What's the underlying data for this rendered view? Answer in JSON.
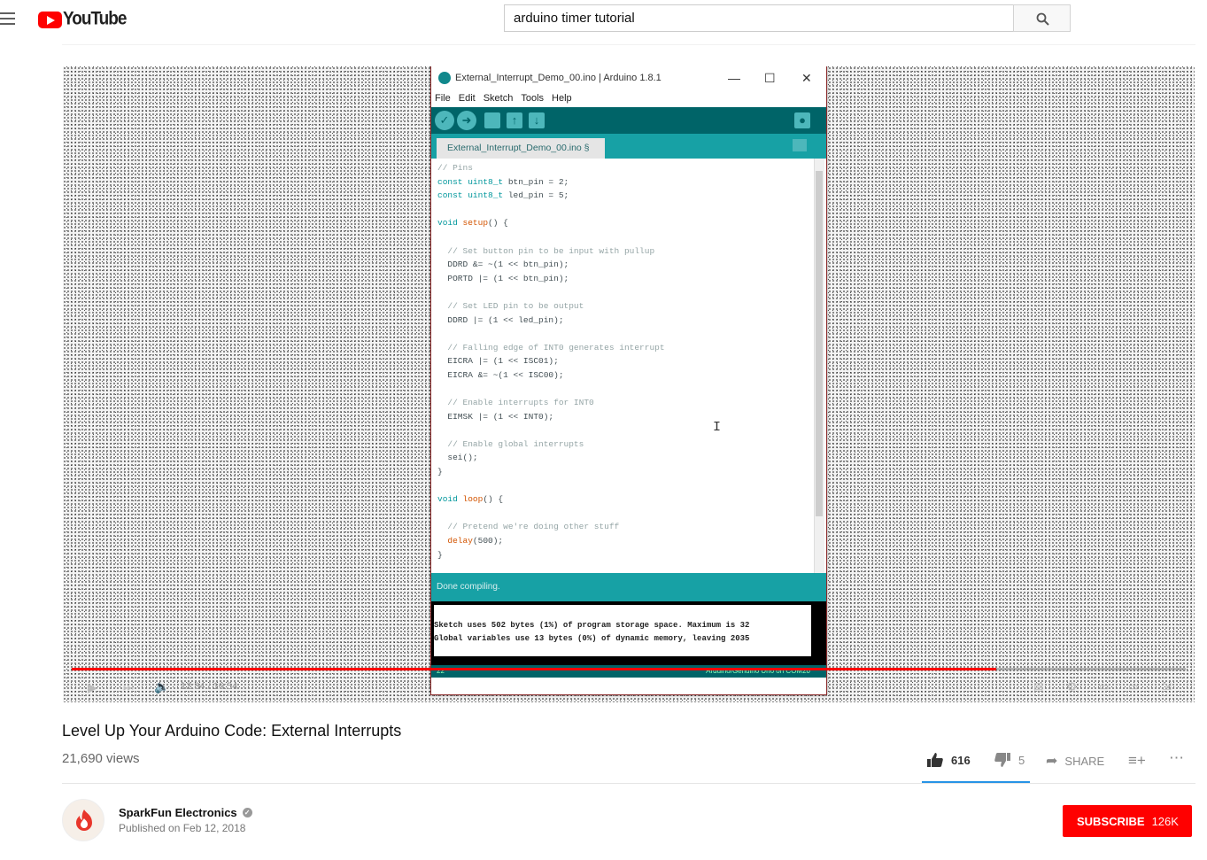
{
  "masthead": {
    "logo_text": "YouTube",
    "search_value": "arduino timer tutorial"
  },
  "player": {
    "time": "12:34 / 16:54",
    "progress_fraction": 0.83
  },
  "ide": {
    "title": "External_Interrupt_Demo_00.ino | Arduino 1.8.1",
    "menu": [
      "File",
      "Edit",
      "Sketch",
      "Tools",
      "Help"
    ],
    "tab_label": "External_Interrupt_Demo_00.ino §",
    "status": "Done compiling.",
    "console_line1": "Sketch uses 502 bytes (1%) of program storage space. Maximum is 32",
    "console_line2": "Global variables use 13 bytes (0%) of dynamic memory, leaving 2035",
    "footer_line": "22",
    "footer_board": "Arduino/Genuino Uno on COM20"
  },
  "video": {
    "title": "Level Up Your Arduino Code: External Interrupts",
    "views": "21,690 views",
    "likes": "616",
    "dislikes": "5",
    "share_label": "SHARE"
  },
  "channel": {
    "name": "SparkFun Electronics",
    "published": "Published on Feb 12, 2018",
    "subscribe_label": "SUBSCRIBE",
    "subscriber_count": "126K"
  },
  "colors": {
    "brand_red": "#ff0000",
    "arduino_teal": "#17a1a5",
    "arduino_dark": "#006468"
  }
}
